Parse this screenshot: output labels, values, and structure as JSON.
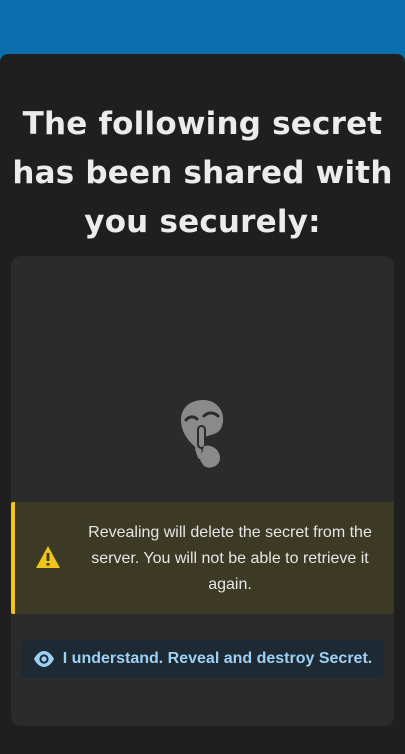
{
  "header": {
    "accent_color": "#0a6fac"
  },
  "page": {
    "title": "The following secret has been shared with you securely:"
  },
  "secret": {
    "icon": "shushing-face-icon"
  },
  "warning": {
    "icon": "warning-triangle-icon",
    "text": "Revealing will delete the secret from the server. You will not be able to retrieve it again.",
    "accent_color": "#f0c419"
  },
  "reveal_button": {
    "icon": "eye-icon",
    "label": "I understand. Reveal and destroy Secret."
  }
}
